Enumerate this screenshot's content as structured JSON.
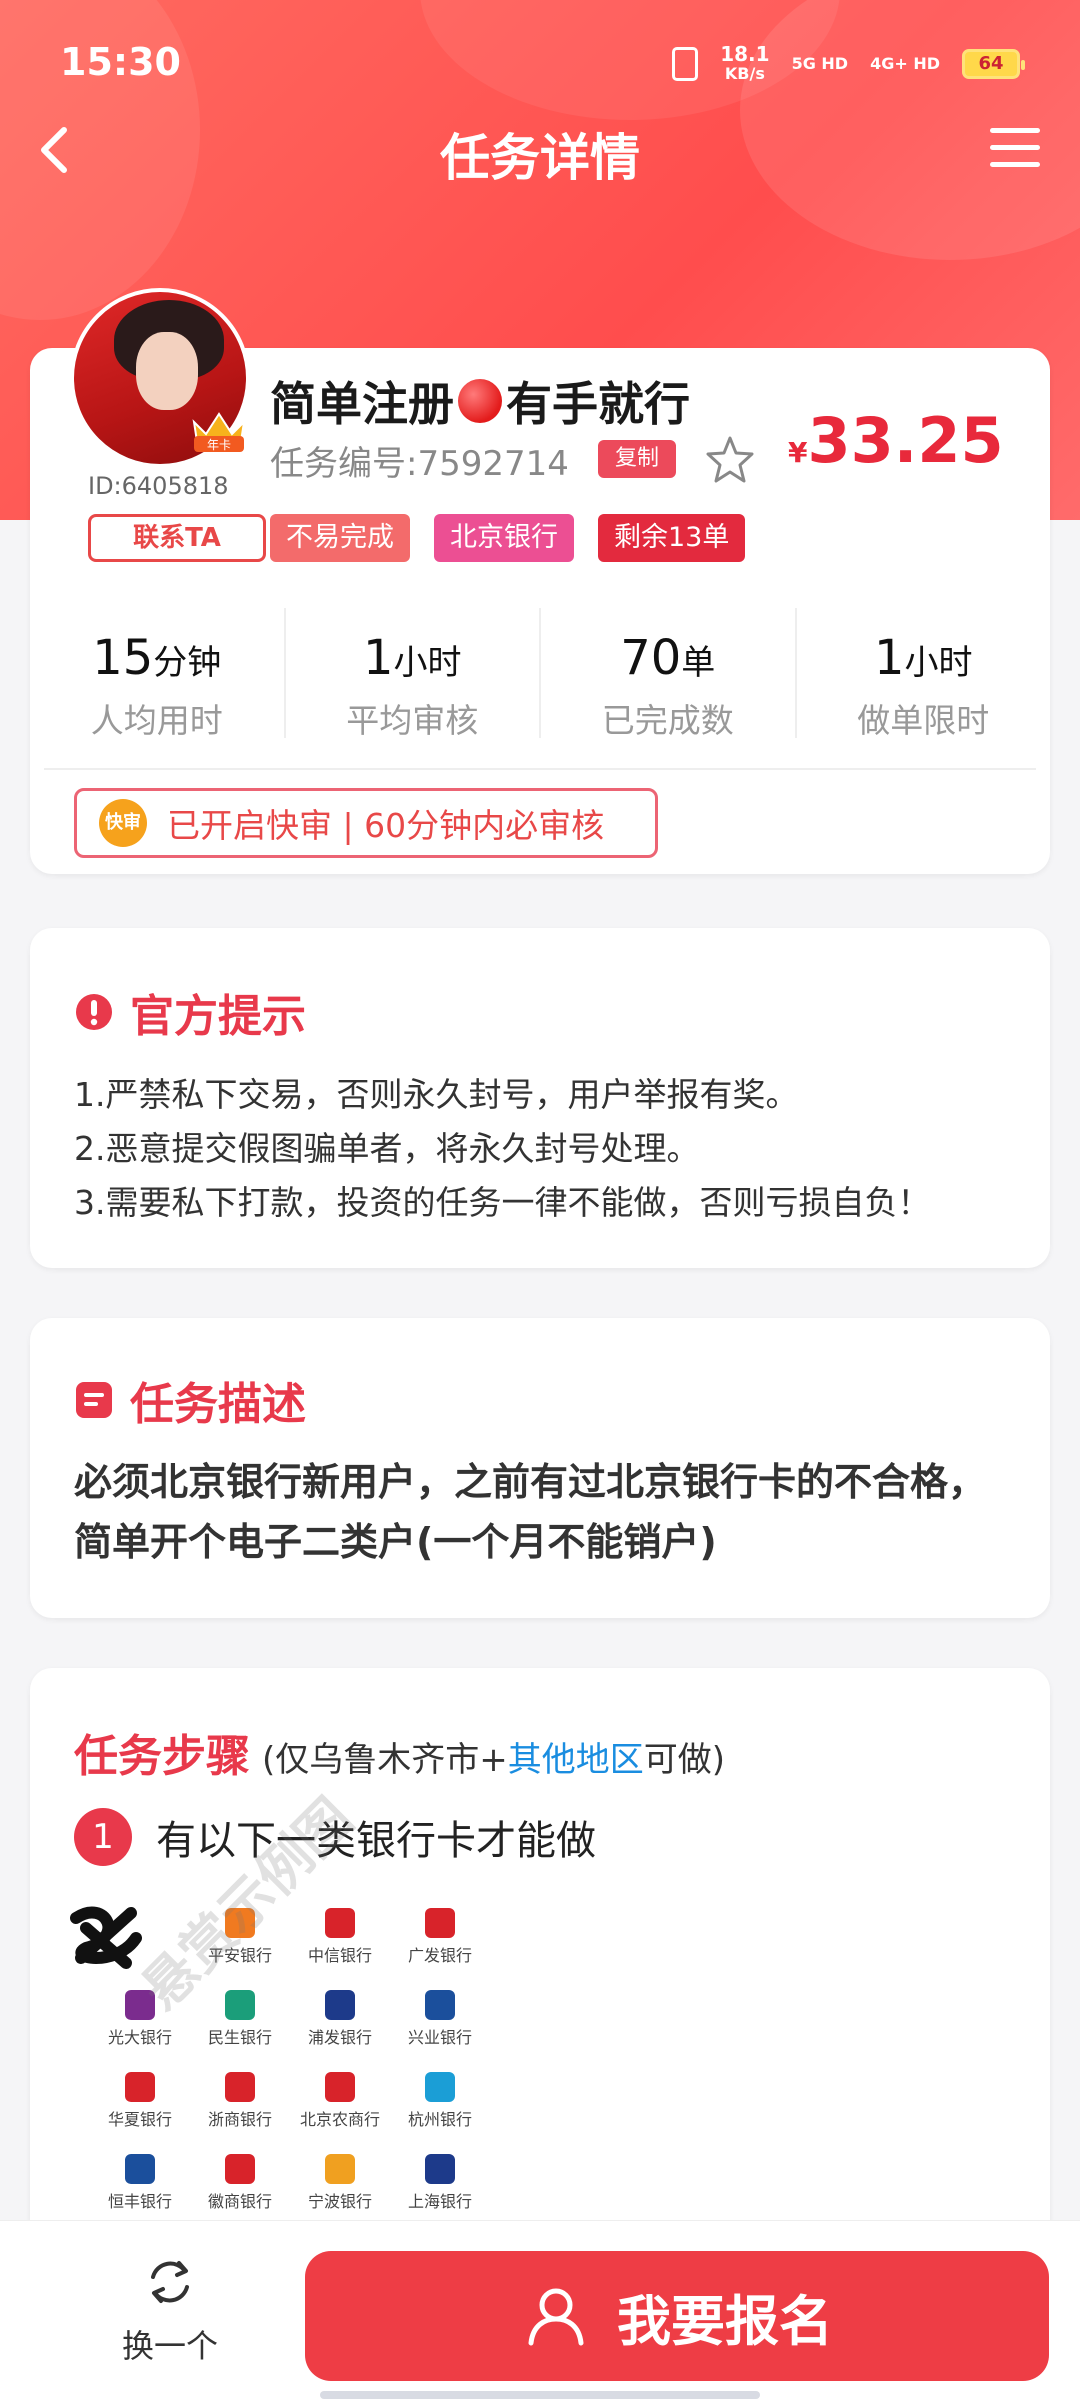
{
  "status": {
    "time": "15:30",
    "net_speed_value": "18.1",
    "net_speed_unit": "KB/s",
    "signal1": "5G HD",
    "signal2": "4G+ HD",
    "battery": "64"
  },
  "nav": {
    "title": "任务详情"
  },
  "task": {
    "title_part1": "简单注册",
    "title_part2": "有手就行",
    "number": "任务编号:7592714",
    "copy_label": "复制",
    "price_currency": "¥",
    "price": "33.25",
    "user_id": "ID:6405818",
    "contact_label": "联系TA",
    "badge_label": "年卡",
    "tags": [
      "不易完成",
      "北京银行",
      "剩余13单"
    ],
    "stats": [
      {
        "value": "15",
        "unit": "分钟",
        "label": "人均用时"
      },
      {
        "value": "1",
        "unit": "小时",
        "label": "平均审核"
      },
      {
        "value": "70",
        "unit": "单",
        "label": "已完成数"
      },
      {
        "value": "1",
        "unit": "小时",
        "label": "做单限时"
      }
    ],
    "fast_icon": "快审",
    "fast_text": "已开启快审 | 60分钟内必审核"
  },
  "notice": {
    "title": "官方提示",
    "items": [
      "1.严禁私下交易，否则永久封号，用户举报有奖。",
      "2.恶意提交假图骗单者，将永久封号处理。",
      "3.需要私下打款，投资的任务一律不能做，否则亏损自负！"
    ]
  },
  "description": {
    "title": "任务描述",
    "text": "必须北京银行新用户，之前有过北京银行卡的不合格，简单开个电子二类户(一个月不能销户)"
  },
  "steps": {
    "title": "任务步骤",
    "note_prefix": "(仅乌鲁木齐市+",
    "note_highlight": "其他地区",
    "note_suffix": "可做)",
    "step1_number": "1",
    "step1_text": "有以下一类银行卡才能做",
    "watermark": "悬赏示例图",
    "banks": [
      {
        "name": "",
        "color": "#000000"
      },
      {
        "name": "平安银行",
        "color": "#f07a20"
      },
      {
        "name": "中信银行",
        "color": "#d8232a"
      },
      {
        "name": "广发银行",
        "color": "#d8232a"
      },
      {
        "name": "光大银行",
        "color": "#7b2c8e"
      },
      {
        "name": "民生银行",
        "color": "#1b9e7a"
      },
      {
        "name": "浦发银行",
        "color": "#1d3a8a"
      },
      {
        "name": "兴业银行",
        "color": "#1b4f9c"
      },
      {
        "name": "华夏银行",
        "color": "#d8232a"
      },
      {
        "name": "浙商银行",
        "color": "#d8232a"
      },
      {
        "name": "北京农商行",
        "color": "#d8232a"
      },
      {
        "name": "杭州银行",
        "color": "#1b9ed6"
      },
      {
        "name": "恒丰银行",
        "color": "#1b4f9c"
      },
      {
        "name": "徽商银行",
        "color": "#d8232a"
      },
      {
        "name": "宁波银行",
        "color": "#f0a020"
      },
      {
        "name": "上海银行",
        "color": "#1d3a8a"
      }
    ]
  },
  "bottom": {
    "switch_label": "换一个",
    "signup_label": "我要报名"
  }
}
